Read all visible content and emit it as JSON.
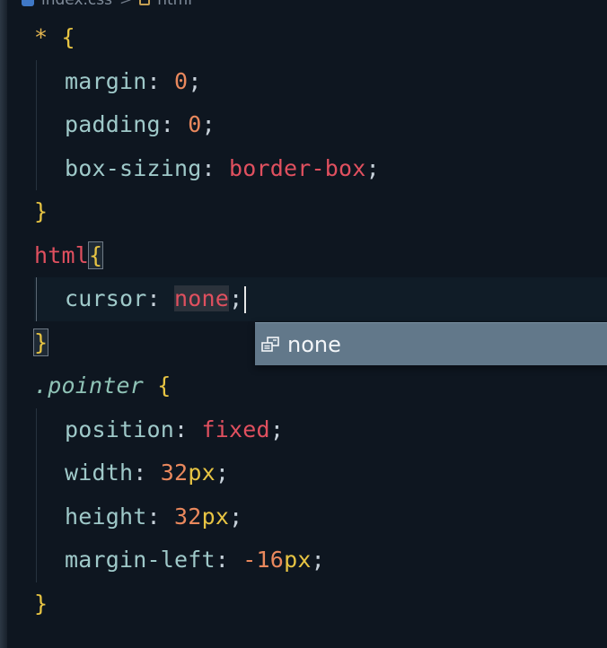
{
  "breadcrumb": {
    "file": "index.css",
    "separator": ">",
    "symbol": "html"
  },
  "code": {
    "l1": {
      "selector": "*",
      "brace": "{"
    },
    "l2": {
      "prop": "margin",
      "colon": ":",
      "value": "0",
      "semi": ";"
    },
    "l3": {
      "prop": "padding",
      "colon": ":",
      "value": "0",
      "semi": ";"
    },
    "l4": {
      "prop": "box-sizing",
      "colon": ":",
      "value": "border-box",
      "semi": ";"
    },
    "l5": {
      "brace": "}"
    },
    "l6": {
      "selector": "html",
      "brace": "{"
    },
    "l7": {
      "prop": "cursor",
      "colon": ":",
      "value": "none",
      "semi": ";"
    },
    "l8": {
      "brace": "}"
    },
    "l9": {
      "selector": ".pointer",
      "brace": "{"
    },
    "l10": {
      "prop": "position",
      "colon": ":",
      "value": "fixed",
      "semi": ";"
    },
    "l11": {
      "prop": "width",
      "colon": ":",
      "num": "32",
      "unit": "px",
      "semi": ";"
    },
    "l12": {
      "prop": "height",
      "colon": ":",
      "num": "32",
      "unit": "px",
      "semi": ";"
    },
    "l13": {
      "prop": "margin-left",
      "colon": ":",
      "num": "-16",
      "unit": "px",
      "semi": ";"
    },
    "l14": {
      "brace": "}"
    }
  },
  "autocomplete": {
    "items": [
      {
        "label": "none",
        "icon": "value-enum-icon"
      }
    ]
  },
  "colors": {
    "background": "#0e1620",
    "suggest_bg": "#62788a",
    "property": "#9fc9c9",
    "keyword": "#e0505f",
    "number": "#e9885d",
    "brace": "#e7c443"
  }
}
